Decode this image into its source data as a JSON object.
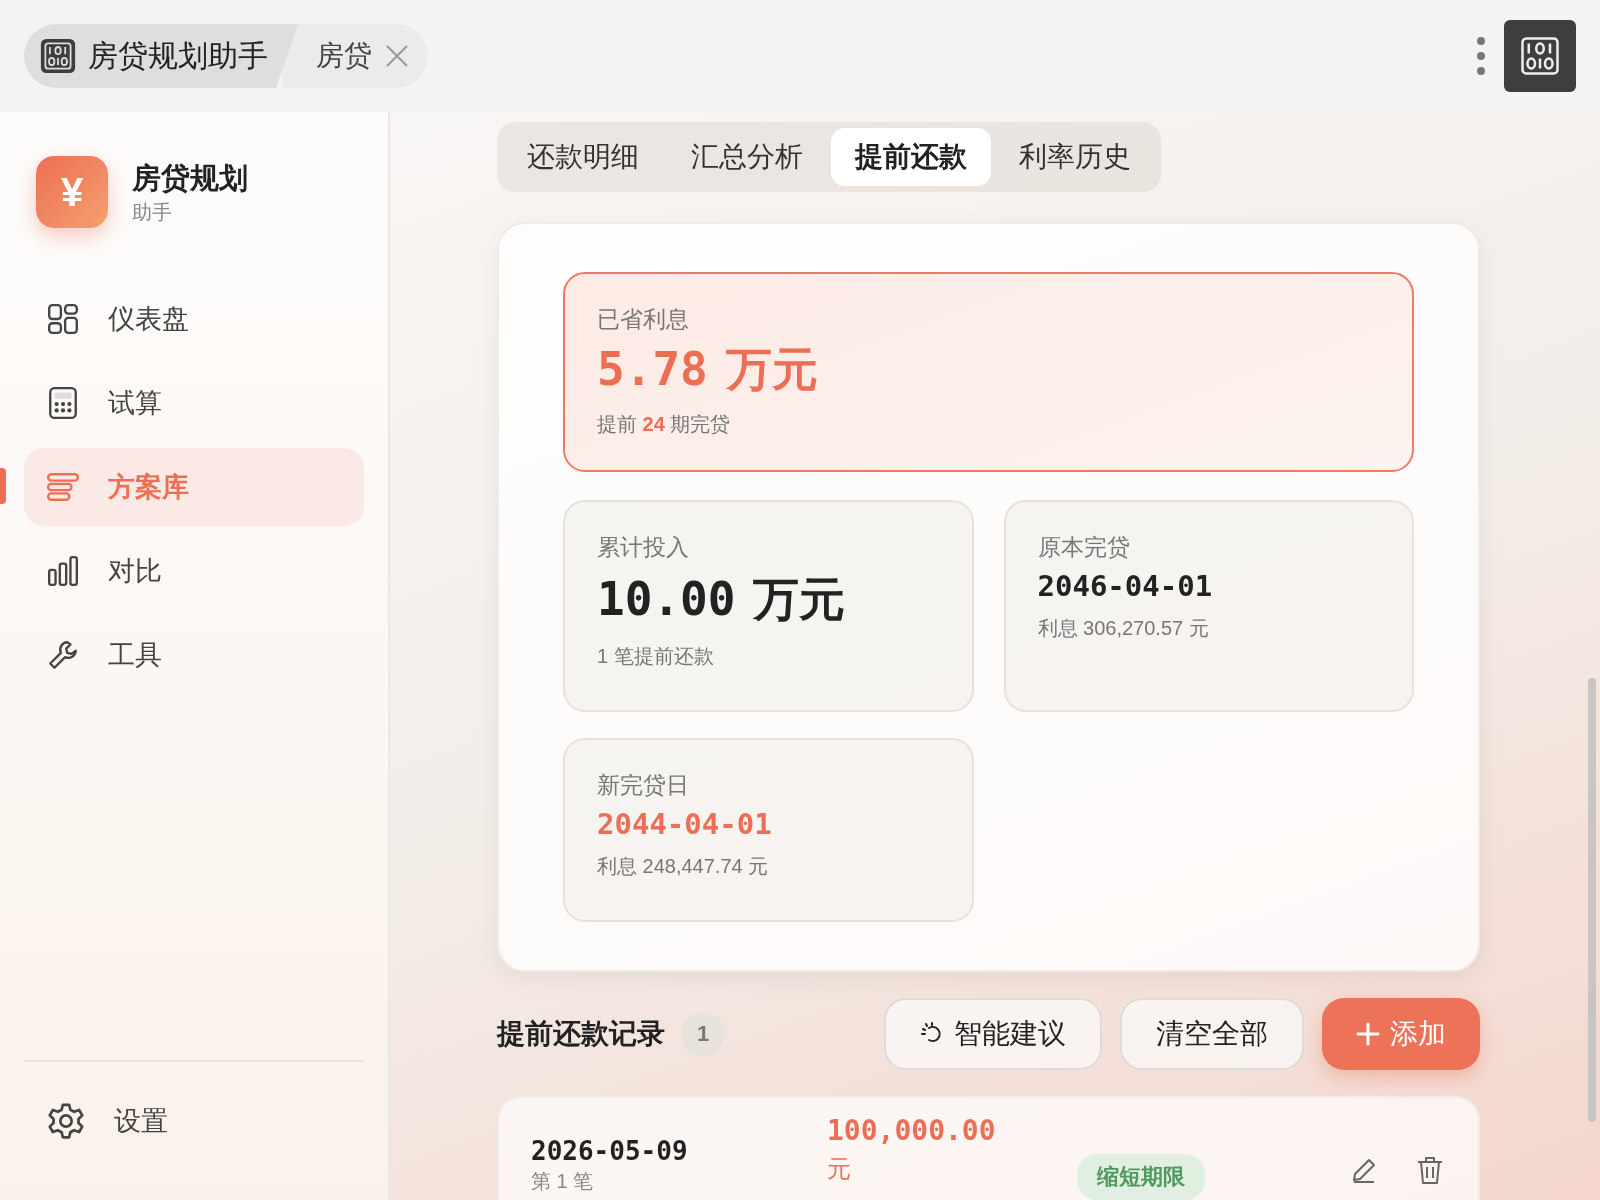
{
  "window": {
    "tabs": [
      {
        "label": "房贷规划助手",
        "selected": true,
        "closable": false
      },
      {
        "label": "房贷",
        "selected": false,
        "closable": true
      }
    ]
  },
  "sidebar": {
    "logo": "¥",
    "app_name": "房贷规划",
    "app_subtitle": "助手",
    "items": [
      {
        "label": "仪表盘",
        "kind": "dashboard",
        "selected": false
      },
      {
        "label": "试算",
        "kind": "calculator",
        "selected": false
      },
      {
        "label": "方案库",
        "kind": "stack",
        "selected": true
      },
      {
        "label": "对比",
        "kind": "bars",
        "selected": false
      },
      {
        "label": "工具",
        "kind": "wrench",
        "selected": false
      }
    ],
    "footer_item": {
      "label": "设置",
      "kind": "gear",
      "selected": false
    }
  },
  "tabs": [
    {
      "label": "还款明细",
      "selected": false
    },
    {
      "label": "汇总分析",
      "selected": false
    },
    {
      "label": "提前还款",
      "selected": true
    },
    {
      "label": "利率历史",
      "selected": false
    }
  ],
  "summary": {
    "saved": {
      "label": "已省利息",
      "value": "5.78",
      "unit": "万元",
      "note": "提前 **24** 期完贷"
    },
    "cards": [
      {
        "kind": "amount",
        "label": "累计投入",
        "value": "10.00",
        "unit": "万元",
        "note": "1 笔提前还款",
        "highlight": false
      },
      {
        "kind": "date",
        "label": "原本完贷",
        "value": "2046-04-01",
        "note": "利息 306,270.57 元",
        "highlight": false
      },
      {
        "kind": "date",
        "label": "新完贷日",
        "value": "2044-04-01",
        "note": "利息 248,447.74 元",
        "highlight": true
      }
    ]
  },
  "records": {
    "title": "提前还款记录",
    "count": "1",
    "buttons": [
      {
        "label": "智能建议",
        "kind": "suggest"
      },
      {
        "label": "清空全部",
        "kind": "plain"
      },
      {
        "label": "添加",
        "kind": "add"
      }
    ],
    "rows": [
      {
        "date": "2026-05-09",
        "index": "第 1 笔",
        "amount": "100,000.00",
        "unit": "元",
        "tag": "缩短期限"
      }
    ]
  }
}
